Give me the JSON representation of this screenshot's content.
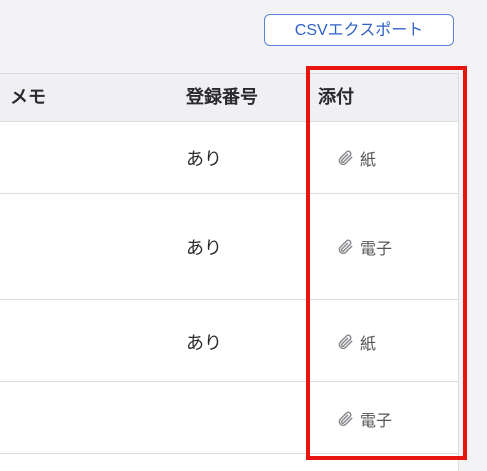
{
  "toolbar": {
    "csv_export_label": "CSVエクスポート"
  },
  "table": {
    "columns": {
      "memo": "メモ",
      "registration_number": "登録番号",
      "attachment": "添付"
    },
    "rows": [
      {
        "registration_number": "あり",
        "attachment": "紙",
        "attachment_icon": "paperclip-icon"
      },
      {
        "registration_number": "あり",
        "attachment": "電子",
        "attachment_icon": "paperclip-icon"
      },
      {
        "registration_number": "あり",
        "attachment": "紙",
        "attachment_icon": "paperclip-icon"
      },
      {
        "registration_number": "",
        "attachment": "電子",
        "attachment_icon": "paperclip-icon"
      }
    ]
  },
  "colors": {
    "accent": "#2f62c9",
    "highlight": "#e8140f"
  }
}
